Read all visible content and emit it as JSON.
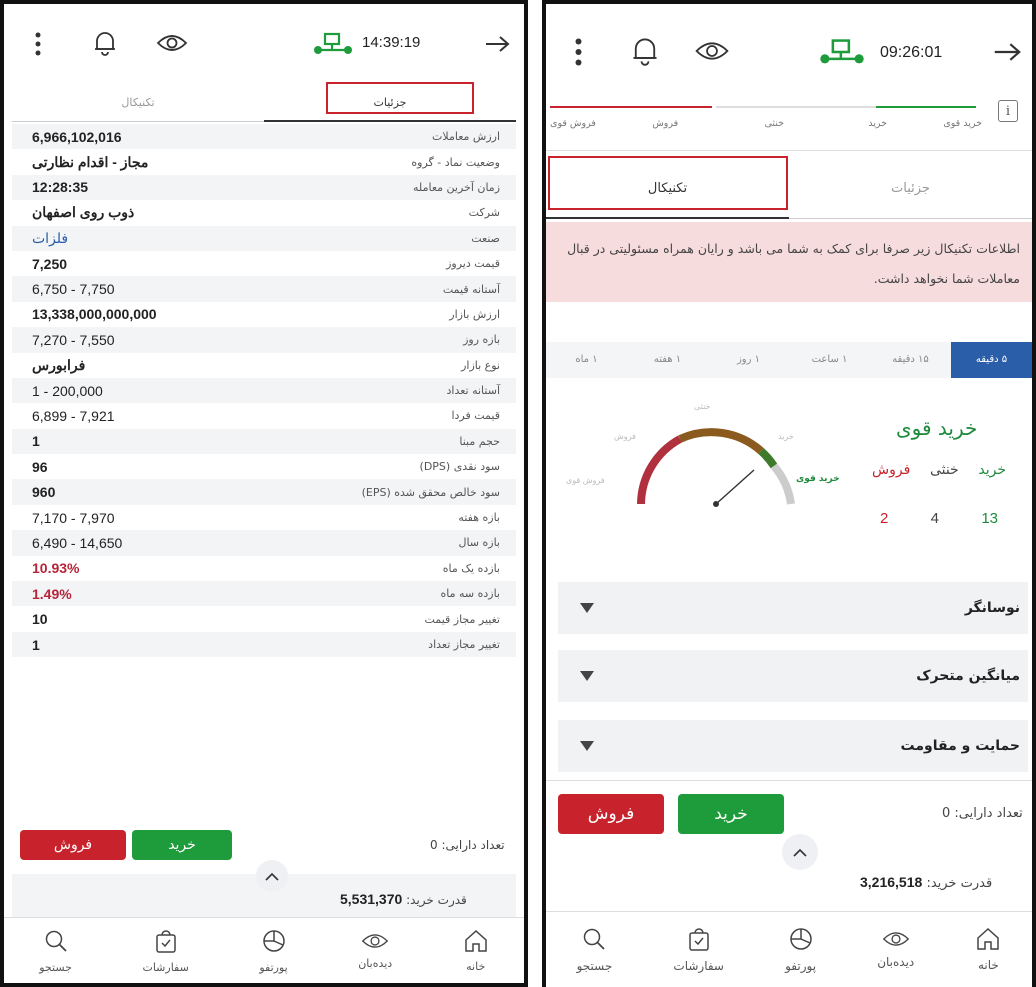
{
  "left": {
    "clock": "14:39:19",
    "tabs": [
      {
        "label": "جزئیات",
        "active": true
      },
      {
        "label": "تکنیکال",
        "active": false
      }
    ],
    "rows": [
      {
        "label": "ارزش معاملات",
        "value": "6,966,102,016",
        "style": "bold"
      },
      {
        "label": "وضعیت نماد - گروه",
        "value": "مجاز - اقدام نظارتی",
        "style": "bold"
      },
      {
        "label": "زمان آخرین معامله",
        "value": "12:28:35",
        "style": "bold"
      },
      {
        "label": "شرکت",
        "value": "ذوب روی اصفهان",
        "style": "bold"
      },
      {
        "label": "صنعت",
        "value": "فلزات",
        "style": "blue"
      },
      {
        "label": "قیمت دیروز",
        "value": "7,250",
        "style": "bold"
      },
      {
        "label": "آستانه قیمت",
        "value": "6,750 - 7,750",
        "style": "normal"
      },
      {
        "label": "ارزش بازار",
        "value": "13,338,000,000,000",
        "style": "bold"
      },
      {
        "label": "بازه روز",
        "value": "7,270 - 7,550",
        "style": "normal"
      },
      {
        "label": "نوع بازار",
        "value": "فرابورس",
        "style": "bold"
      },
      {
        "label": "آستانه تعداد",
        "value": "1 - 200,000",
        "style": "normal"
      },
      {
        "label": "قیمت فردا",
        "value": "6,899 - 7,921",
        "style": "normal"
      },
      {
        "label": "حجم مبنا",
        "value": "1",
        "style": "bold"
      },
      {
        "label": "سود نقدی (DPS)",
        "value": "96",
        "style": "bold"
      },
      {
        "label": "سود خالص محقق شده (EPS)",
        "value": "960",
        "style": "bold"
      },
      {
        "label": "بازه هفته",
        "value": "7,170 - 7,970",
        "style": "normal"
      },
      {
        "label": "بازه سال",
        "value": "6,490 - 14,650",
        "style": "normal"
      },
      {
        "label": "بازده یک ماه",
        "value": "10.93%",
        "style": "red"
      },
      {
        "label": "بازده سه ماه",
        "value": "1.49%",
        "style": "red"
      },
      {
        "label": "تغییر مجاز قیمت",
        "value": "10",
        "style": "bold"
      },
      {
        "label": "تغییر مجاز تعداد",
        "value": "1",
        "style": "bold"
      }
    ],
    "sell_label": "فروش",
    "buy_label": "خرید",
    "holding_label": "تعداد دارایی:",
    "holding_value": "0",
    "power_label": "قدرت خرید:",
    "power_value": "5,531,370"
  },
  "right": {
    "clock": "09:26:01",
    "sentiment_labels": [
      "خرید قوی",
      "خرید",
      "خنثی",
      "فروش",
      "فروش قوی"
    ],
    "tabs": [
      {
        "label": "جزئیات",
        "active": false
      },
      {
        "label": "تکنیکال",
        "active": true
      }
    ],
    "alert_text": "اطلاعات تکنیکال زیر صرفا برای کمک به شما می باشد و رایان همراه مسئولیتی در قبال معاملات شما نخواهد داشت.",
    "timeframes": [
      "۵ دقیقه",
      "۱۵ دقیقه",
      "۱ ساعت",
      "۱ روز",
      "۱ هفته",
      "۱ ماه"
    ],
    "active_timeframe": 0,
    "gauge": {
      "labels": [
        "فروش قوی",
        "فروش",
        "خنثی",
        "خرید",
        "خرید قوی"
      ],
      "needle_label": "خرید قوی",
      "needle_label_short": "خرید قوی",
      "verdict": "خرید قوی",
      "counts": [
        {
          "label": "خرید",
          "value": "13",
          "color": "#1e8a3c"
        },
        {
          "label": "خنثی",
          "value": "4",
          "color": "#444444"
        },
        {
          "label": "فروش",
          "value": "2",
          "color": "#c8232c"
        }
      ]
    },
    "accordions": [
      "نوسانگر",
      "میانگین متحرک",
      "حمایت و مقاومت"
    ],
    "sell_label": "فروش",
    "buy_label": "خرید",
    "holding_label": "تعداد دارایی:",
    "holding_value": "0",
    "power_label": "قدرت خرید:",
    "power_value": "3,216,518"
  },
  "nav": [
    {
      "label": "خانه",
      "icon": "home-icon"
    },
    {
      "label": "دیده‌بان",
      "icon": "eye-icon"
    },
    {
      "label": "پورتفو",
      "icon": "pie-chart-icon"
    },
    {
      "label": "سفارشات",
      "icon": "shopping-bag-icon"
    },
    {
      "label": "جستجو",
      "icon": "search-icon"
    }
  ],
  "colors": {
    "accent_blue": "#2a5ea8",
    "buy_green": "#1e9b3a",
    "sell_red": "#c8232c",
    "alert_bg": "#f7dcde"
  }
}
